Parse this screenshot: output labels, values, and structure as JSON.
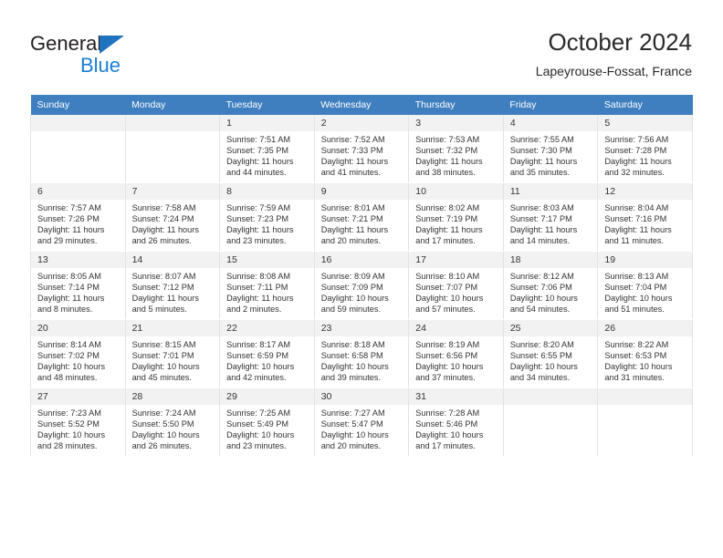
{
  "brand": {
    "name_top": "General",
    "name_bottom": "Blue",
    "triangle_icon": "triangle-icon",
    "accent_color": "#1b7fd4"
  },
  "header": {
    "title": "October 2024",
    "location": "Lapeyrouse-Fossat, France"
  },
  "calendar": {
    "header_bg": "#3f7fbf",
    "daynum_bg": "#f2f2f2",
    "weekday_headers": [
      "Sunday",
      "Monday",
      "Tuesday",
      "Wednesday",
      "Thursday",
      "Friday",
      "Saturday"
    ],
    "weeks": [
      [
        {
          "day": "",
          "sunrise": "",
          "sunset": "",
          "daylight1": "",
          "daylight2": ""
        },
        {
          "day": "",
          "sunrise": "",
          "sunset": "",
          "daylight1": "",
          "daylight2": ""
        },
        {
          "day": "1",
          "sunrise": "Sunrise: 7:51 AM",
          "sunset": "Sunset: 7:35 PM",
          "daylight1": "Daylight: 11 hours",
          "daylight2": "and 44 minutes."
        },
        {
          "day": "2",
          "sunrise": "Sunrise: 7:52 AM",
          "sunset": "Sunset: 7:33 PM",
          "daylight1": "Daylight: 11 hours",
          "daylight2": "and 41 minutes."
        },
        {
          "day": "3",
          "sunrise": "Sunrise: 7:53 AM",
          "sunset": "Sunset: 7:32 PM",
          "daylight1": "Daylight: 11 hours",
          "daylight2": "and 38 minutes."
        },
        {
          "day": "4",
          "sunrise": "Sunrise: 7:55 AM",
          "sunset": "Sunset: 7:30 PM",
          "daylight1": "Daylight: 11 hours",
          "daylight2": "and 35 minutes."
        },
        {
          "day": "5",
          "sunrise": "Sunrise: 7:56 AM",
          "sunset": "Sunset: 7:28 PM",
          "daylight1": "Daylight: 11 hours",
          "daylight2": "and 32 minutes."
        }
      ],
      [
        {
          "day": "6",
          "sunrise": "Sunrise: 7:57 AM",
          "sunset": "Sunset: 7:26 PM",
          "daylight1": "Daylight: 11 hours",
          "daylight2": "and 29 minutes."
        },
        {
          "day": "7",
          "sunrise": "Sunrise: 7:58 AM",
          "sunset": "Sunset: 7:24 PM",
          "daylight1": "Daylight: 11 hours",
          "daylight2": "and 26 minutes."
        },
        {
          "day": "8",
          "sunrise": "Sunrise: 7:59 AM",
          "sunset": "Sunset: 7:23 PM",
          "daylight1": "Daylight: 11 hours",
          "daylight2": "and 23 minutes."
        },
        {
          "day": "9",
          "sunrise": "Sunrise: 8:01 AM",
          "sunset": "Sunset: 7:21 PM",
          "daylight1": "Daylight: 11 hours",
          "daylight2": "and 20 minutes."
        },
        {
          "day": "10",
          "sunrise": "Sunrise: 8:02 AM",
          "sunset": "Sunset: 7:19 PM",
          "daylight1": "Daylight: 11 hours",
          "daylight2": "and 17 minutes."
        },
        {
          "day": "11",
          "sunrise": "Sunrise: 8:03 AM",
          "sunset": "Sunset: 7:17 PM",
          "daylight1": "Daylight: 11 hours",
          "daylight2": "and 14 minutes."
        },
        {
          "day": "12",
          "sunrise": "Sunrise: 8:04 AM",
          "sunset": "Sunset: 7:16 PM",
          "daylight1": "Daylight: 11 hours",
          "daylight2": "and 11 minutes."
        }
      ],
      [
        {
          "day": "13",
          "sunrise": "Sunrise: 8:05 AM",
          "sunset": "Sunset: 7:14 PM",
          "daylight1": "Daylight: 11 hours",
          "daylight2": "and 8 minutes."
        },
        {
          "day": "14",
          "sunrise": "Sunrise: 8:07 AM",
          "sunset": "Sunset: 7:12 PM",
          "daylight1": "Daylight: 11 hours",
          "daylight2": "and 5 minutes."
        },
        {
          "day": "15",
          "sunrise": "Sunrise: 8:08 AM",
          "sunset": "Sunset: 7:11 PM",
          "daylight1": "Daylight: 11 hours",
          "daylight2": "and 2 minutes."
        },
        {
          "day": "16",
          "sunrise": "Sunrise: 8:09 AM",
          "sunset": "Sunset: 7:09 PM",
          "daylight1": "Daylight: 10 hours",
          "daylight2": "and 59 minutes."
        },
        {
          "day": "17",
          "sunrise": "Sunrise: 8:10 AM",
          "sunset": "Sunset: 7:07 PM",
          "daylight1": "Daylight: 10 hours",
          "daylight2": "and 57 minutes."
        },
        {
          "day": "18",
          "sunrise": "Sunrise: 8:12 AM",
          "sunset": "Sunset: 7:06 PM",
          "daylight1": "Daylight: 10 hours",
          "daylight2": "and 54 minutes."
        },
        {
          "day": "19",
          "sunrise": "Sunrise: 8:13 AM",
          "sunset": "Sunset: 7:04 PM",
          "daylight1": "Daylight: 10 hours",
          "daylight2": "and 51 minutes."
        }
      ],
      [
        {
          "day": "20",
          "sunrise": "Sunrise: 8:14 AM",
          "sunset": "Sunset: 7:02 PM",
          "daylight1": "Daylight: 10 hours",
          "daylight2": "and 48 minutes."
        },
        {
          "day": "21",
          "sunrise": "Sunrise: 8:15 AM",
          "sunset": "Sunset: 7:01 PM",
          "daylight1": "Daylight: 10 hours",
          "daylight2": "and 45 minutes."
        },
        {
          "day": "22",
          "sunrise": "Sunrise: 8:17 AM",
          "sunset": "Sunset: 6:59 PM",
          "daylight1": "Daylight: 10 hours",
          "daylight2": "and 42 minutes."
        },
        {
          "day": "23",
          "sunrise": "Sunrise: 8:18 AM",
          "sunset": "Sunset: 6:58 PM",
          "daylight1": "Daylight: 10 hours",
          "daylight2": "and 39 minutes."
        },
        {
          "day": "24",
          "sunrise": "Sunrise: 8:19 AM",
          "sunset": "Sunset: 6:56 PM",
          "daylight1": "Daylight: 10 hours",
          "daylight2": "and 37 minutes."
        },
        {
          "day": "25",
          "sunrise": "Sunrise: 8:20 AM",
          "sunset": "Sunset: 6:55 PM",
          "daylight1": "Daylight: 10 hours",
          "daylight2": "and 34 minutes."
        },
        {
          "day": "26",
          "sunrise": "Sunrise: 8:22 AM",
          "sunset": "Sunset: 6:53 PM",
          "daylight1": "Daylight: 10 hours",
          "daylight2": "and 31 minutes."
        }
      ],
      [
        {
          "day": "27",
          "sunrise": "Sunrise: 7:23 AM",
          "sunset": "Sunset: 5:52 PM",
          "daylight1": "Daylight: 10 hours",
          "daylight2": "and 28 minutes."
        },
        {
          "day": "28",
          "sunrise": "Sunrise: 7:24 AM",
          "sunset": "Sunset: 5:50 PM",
          "daylight1": "Daylight: 10 hours",
          "daylight2": "and 26 minutes."
        },
        {
          "day": "29",
          "sunrise": "Sunrise: 7:25 AM",
          "sunset": "Sunset: 5:49 PM",
          "daylight1": "Daylight: 10 hours",
          "daylight2": "and 23 minutes."
        },
        {
          "day": "30",
          "sunrise": "Sunrise: 7:27 AM",
          "sunset": "Sunset: 5:47 PM",
          "daylight1": "Daylight: 10 hours",
          "daylight2": "and 20 minutes."
        },
        {
          "day": "31",
          "sunrise": "Sunrise: 7:28 AM",
          "sunset": "Sunset: 5:46 PM",
          "daylight1": "Daylight: 10 hours",
          "daylight2": "and 17 minutes."
        },
        {
          "day": "",
          "sunrise": "",
          "sunset": "",
          "daylight1": "",
          "daylight2": ""
        },
        {
          "day": "",
          "sunrise": "",
          "sunset": "",
          "daylight1": "",
          "daylight2": ""
        }
      ]
    ]
  }
}
